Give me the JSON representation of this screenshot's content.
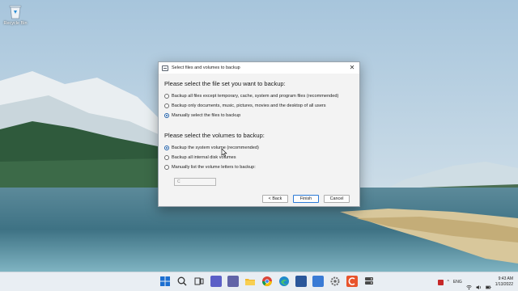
{
  "desktop": {
    "icon_label": "Recycle Bin"
  },
  "dialog": {
    "title": "Select files and volumes to backup",
    "close_glyph": "✕",
    "fileset_heading": "Please select the file set you want to backup:",
    "fileset_options": [
      {
        "label": "Backup all files except temporary, cache, system and program files (recommended)",
        "selected": false
      },
      {
        "label": "Backup only documents, music, pictures, movies and the desktop of all users",
        "selected": false
      },
      {
        "label": "Manually select the files to backup",
        "selected": true
      }
    ],
    "volumes_heading": "Please select the volumes to backup:",
    "volume_options": [
      {
        "label": "Backup the system volume (recommended)",
        "selected": true
      },
      {
        "label": "Backup all internal disk volumes",
        "selected": false
      },
      {
        "label": "Manually list the volume letters to backup:",
        "selected": false
      }
    ],
    "volume_letters_value": "C",
    "buttons": {
      "back": "< Back",
      "finish": "Finish",
      "cancel": "Cancel"
    }
  },
  "taskbar": {
    "apps": [
      "start-icon",
      "search-icon",
      "task-view-icon",
      "widgets-icon",
      "chat-icon",
      "file-explorer-icon",
      "chrome-icon",
      "edge-icon",
      "word-icon",
      "store-icon",
      "settings-icon",
      "backup-app-icon",
      "drive-icon"
    ],
    "app_colors": [
      "#1c6fd1",
      "#333333",
      "#333333",
      "#5b5fc7",
      "#6264a7",
      "#f2b72b",
      "#db4437",
      "#1f8acb",
      "#2b579a",
      "#3a7bd5",
      "#6b6b6b",
      "#e8542c",
      "#4a4a4a"
    ],
    "tray": {
      "language": "ENG",
      "time": "9:43 AM",
      "date": "1/13/2022"
    }
  }
}
